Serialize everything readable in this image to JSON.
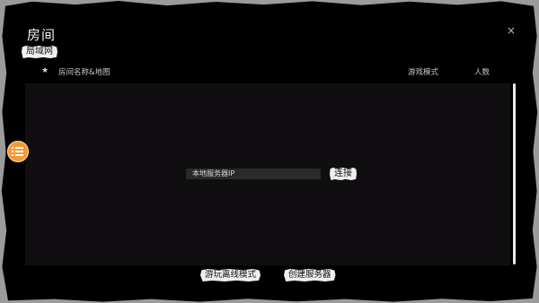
{
  "window": {
    "title": "房间",
    "close_icon": "close-icon",
    "close_glyph": "×"
  },
  "tabs": {
    "lan_label": "局域网"
  },
  "table": {
    "favorite_glyph": "★",
    "columns": [
      "房间名称&地图",
      "游戏模式",
      "人数"
    ],
    "rows": []
  },
  "connect": {
    "ip_placeholder": "本地服务器IP",
    "connect_label": "连接"
  },
  "footer": {
    "offline_label": "游玩离线模式",
    "create_server_label": "创建服务器"
  },
  "colors": {
    "background": "#000000",
    "accent": "#f29b36",
    "chip": "#efefef"
  }
}
